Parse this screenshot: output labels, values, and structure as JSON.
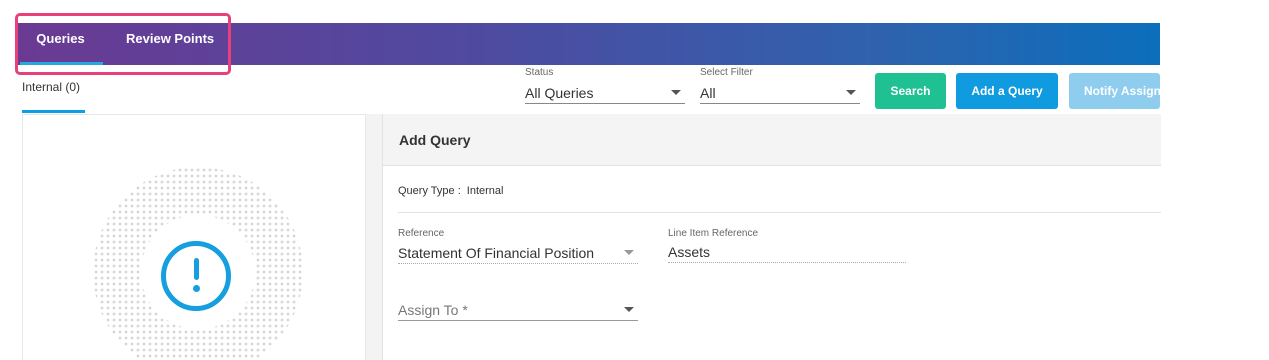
{
  "header": {
    "tabs": [
      {
        "label": "Queries",
        "active": true
      },
      {
        "label": "Review Points",
        "active": false
      }
    ]
  },
  "subtabs": {
    "internal": "Internal (0)"
  },
  "filters": {
    "status": {
      "label": "Status",
      "value": "All Queries"
    },
    "select_filter": {
      "label": "Select Filter",
      "value": "All"
    }
  },
  "buttons": {
    "search": "Search",
    "add_query": "Add a Query",
    "notify": "Notify Assign"
  },
  "empty_state": {
    "icon": "alert-circle-icon"
  },
  "add_query": {
    "title": "Add Query",
    "query_type_label": "Query Type :",
    "query_type_value": "Internal",
    "reference": {
      "label": "Reference",
      "value": "Statement Of Financial Position"
    },
    "line_item_reference": {
      "label": "Line Item Reference",
      "value": "Assets"
    },
    "assign_to": {
      "placeholder": "Assign To *"
    }
  },
  "colors": {
    "header_gradient_start": "#6a3a93",
    "header_gradient_end": "#0b6fbc",
    "search_button": "#1fc193",
    "add_button": "#109be1",
    "notify_button": "#8fcdef",
    "highlight": "#e8407a",
    "accent": "#159fdf"
  }
}
